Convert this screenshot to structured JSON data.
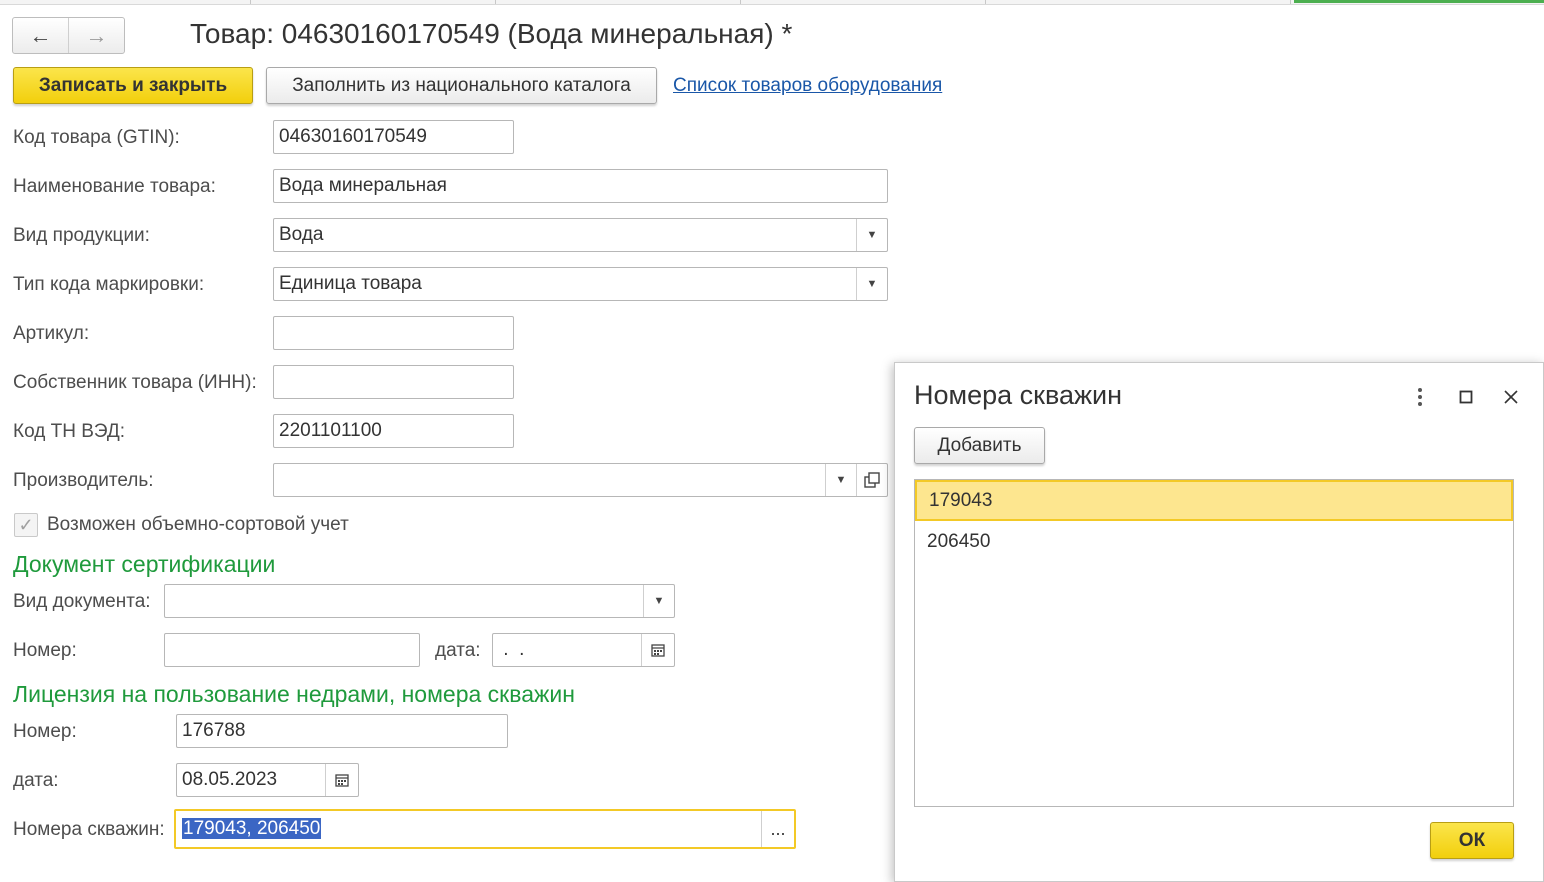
{
  "window": {
    "title": "Товар: 04630160170549 (Вода минеральная) *"
  },
  "nav": {
    "back_icon": "arrow-left-icon",
    "forward_icon": "arrow-right-icon"
  },
  "toolbar": {
    "save_close_label": "Записать и закрыть",
    "fill_catalog_label": "Заполнить из национального каталога",
    "equipment_list_link": "Список товаров оборудования"
  },
  "form": {
    "gtin": {
      "label": "Код товара (GTIN):",
      "value": "04630160170549"
    },
    "name": {
      "label": "Наименование товара:",
      "value": "Вода минеральная"
    },
    "product_type": {
      "label": "Вид продукции:",
      "value": "Вода"
    },
    "marking_type": {
      "label": "Тип кода маркировки:",
      "value": "Единица товара"
    },
    "article": {
      "label": "Артикул:",
      "value": ""
    },
    "owner": {
      "label": "Собственник товара (ИНН):",
      "value": ""
    },
    "tnved": {
      "label": "Код ТН ВЭД:",
      "value": "2201101100"
    },
    "manufacturer": {
      "label": "Производитель:",
      "value": ""
    },
    "volume_sort": {
      "label": "Возможен объемно-сортовой учет",
      "checked": true
    }
  },
  "cert_section": {
    "title": "Документ сертификации",
    "doc_type": {
      "label": "Вид документа:",
      "value": ""
    },
    "number": {
      "label": "Номер:",
      "value": ""
    },
    "date": {
      "label": "дата:",
      "value": " .  ."
    }
  },
  "license_section": {
    "title": "Лицензия на пользование недрами, номера скважин",
    "number": {
      "label": "Номер:",
      "value": "176788"
    },
    "date": {
      "label": "дата:",
      "value": "08.05.2023"
    },
    "wells": {
      "label": "Номера скважин:",
      "value": "179043, 206450",
      "button": "..."
    }
  },
  "dialog": {
    "title": "Номера скважин",
    "add_label": "Добавить",
    "items": [
      "179043",
      "206450"
    ],
    "selected_index": 0,
    "ok_label": "ОК"
  },
  "colors": {
    "accent_yellow": "#f3c926",
    "section_green": "#1f9a3c",
    "link_blue": "#1a57a8",
    "selection_blue": "#3b66c4"
  }
}
